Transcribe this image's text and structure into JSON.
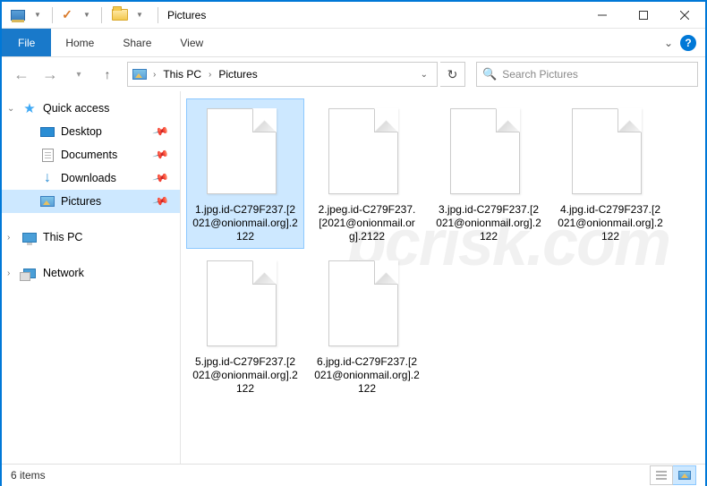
{
  "window": {
    "title": "Pictures"
  },
  "ribbon": {
    "file": "File",
    "tabs": [
      "Home",
      "Share",
      "View"
    ]
  },
  "breadcrumb": {
    "items": [
      "This PC",
      "Pictures"
    ]
  },
  "search": {
    "placeholder": "Search Pictures"
  },
  "sidebar": {
    "quick_access": "Quick access",
    "items": [
      {
        "label": "Desktop",
        "pinned": true
      },
      {
        "label": "Documents",
        "pinned": true
      },
      {
        "label": "Downloads",
        "pinned": true
      },
      {
        "label": "Pictures",
        "pinned": true,
        "selected": true
      }
    ],
    "this_pc": "This PC",
    "network": "Network"
  },
  "files": [
    {
      "name": "1.jpg.id-C279F237.[2021@onionmail.org].2122",
      "selected": true
    },
    {
      "name": "2.jpeg.id-C279F237.[2021@onionmail.org].2122",
      "selected": false
    },
    {
      "name": "3.jpg.id-C279F237.[2021@onionmail.org].2122",
      "selected": false
    },
    {
      "name": "4.jpg.id-C279F237.[2021@onionmail.org].2122",
      "selected": false
    },
    {
      "name": "5.jpg.id-C279F237.[2021@onionmail.org].2122",
      "selected": false
    },
    {
      "name": "6.jpg.id-C279F237.[2021@onionmail.org].2122",
      "selected": false
    }
  ],
  "status": {
    "count": "6 items"
  },
  "watermark": "pcrisk.com"
}
